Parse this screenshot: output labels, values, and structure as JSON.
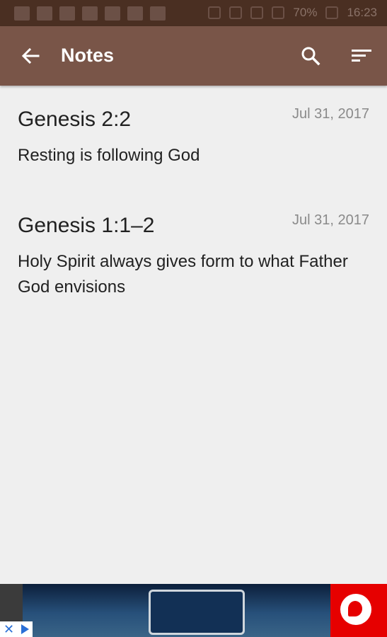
{
  "status_bar": {
    "battery": "70%",
    "time": "16:23"
  },
  "app_bar": {
    "title": "Notes",
    "back_icon": "arrow-back-icon",
    "search_icon": "search-icon",
    "sort_icon": "sort-icon"
  },
  "notes": [
    {
      "title": "Genesis 2:2",
      "date": "Jul 31, 2017",
      "body": "Resting is following God"
    },
    {
      "title": "Genesis 1:1–2",
      "date": "Jul 31, 2017",
      "body": "Holy Spirit always gives form to what Father God envisions"
    }
  ],
  "colors": {
    "status_bar": "#4a2f22",
    "app_bar": "#795548",
    "background": "#efefef",
    "ad_accent": "#e60000"
  },
  "ad": {
    "close_icon": "close-icon",
    "adchoices_icon": "adchoices-icon",
    "brand_logo": "vodafone-logo"
  }
}
